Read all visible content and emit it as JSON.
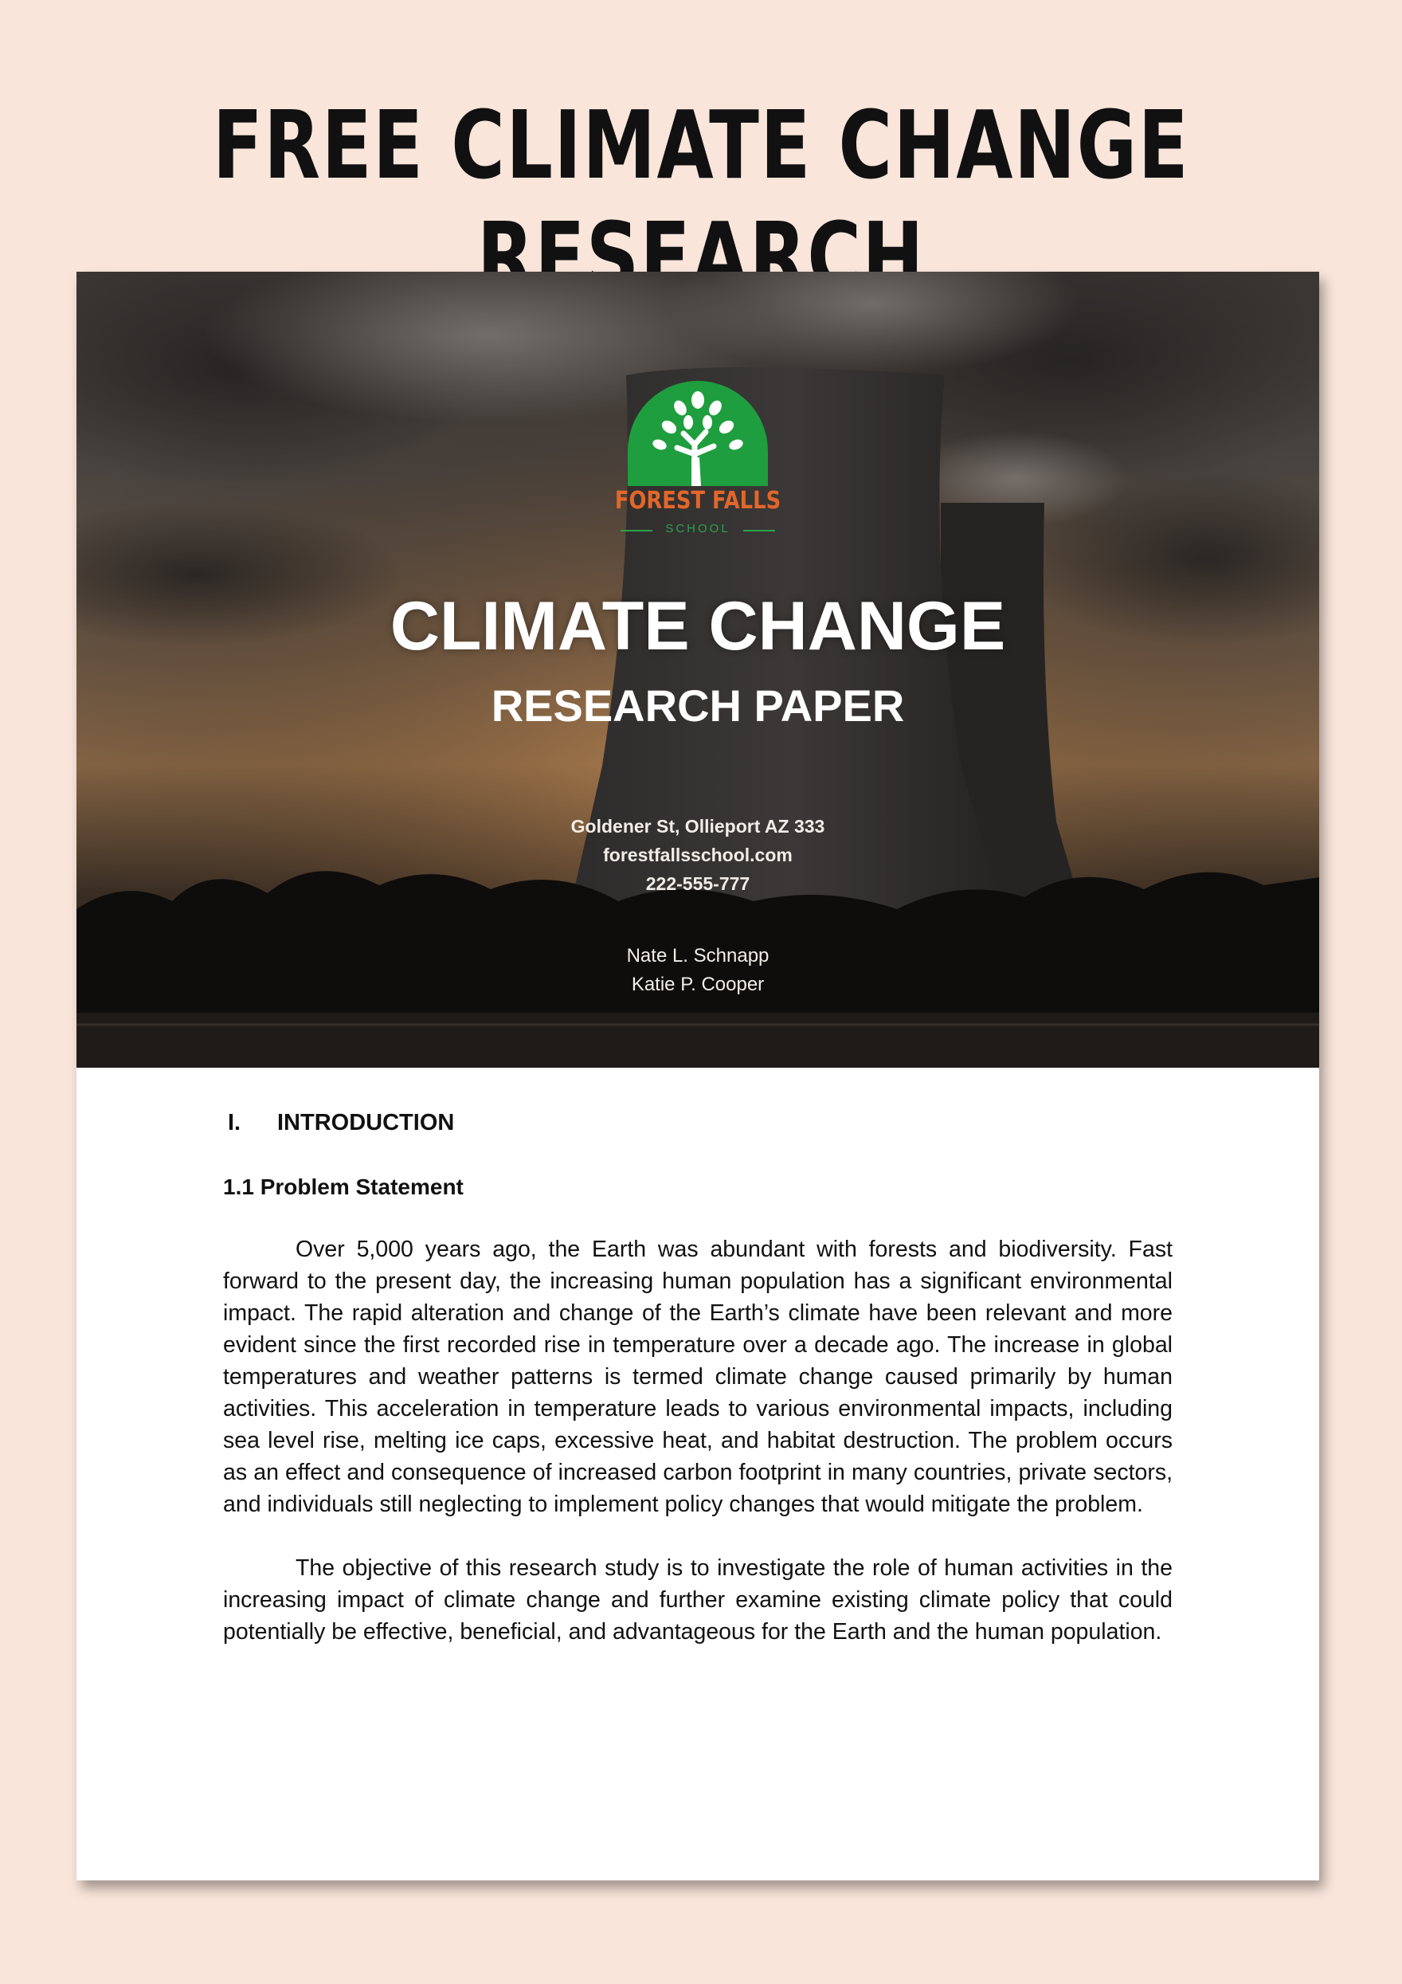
{
  "page_heading": "FREE CLIMATE CHANGE RESEARCH",
  "cover": {
    "logo": {
      "name": "FOREST FALLS",
      "sub": "SCHOOL"
    },
    "title": "CLIMATE CHANGE",
    "subtitle": "RESEARCH PAPER",
    "contact": [
      "Goldener St, Ollieport AZ 333",
      "forestfallsschool.com",
      "222-555-777"
    ],
    "authors": [
      "Nate L. Schnapp",
      "Katie P. Cooper"
    ]
  },
  "body": {
    "section_number": "I.",
    "section_title": "INTRODUCTION",
    "subsection_title": "1.1 Problem Statement",
    "paragraphs": [
      "Over 5,000 years ago, the Earth was abundant with forests and biodiversity. Fast forward to the present day, the increasing human population has a significant environmental impact. The rapid alteration and change of the Earth’s climate have been relevant and more evident since the first recorded rise in temperature over a decade ago. The increase in global temperatures and weather patterns is termed climate change caused primarily by human activities. This acceleration in temperature leads to various environmental impacts, including sea level rise, melting ice caps, excessive heat, and habitat destruction. The problem occurs as an effect and consequence of increased carbon footprint in many countries, private sectors, and individuals still neglecting to implement policy changes that would mitigate the problem.",
      "The objective of this research study is to investigate the role of human activities in the increasing impact of climate change and further examine existing climate policy that could potentially be effective, beneficial, and advantageous for the Earth and the human population."
    ]
  },
  "colors": {
    "background": "#f9e5da",
    "logo_green": "#1e9e3e",
    "logo_orange": "#e2672a"
  }
}
